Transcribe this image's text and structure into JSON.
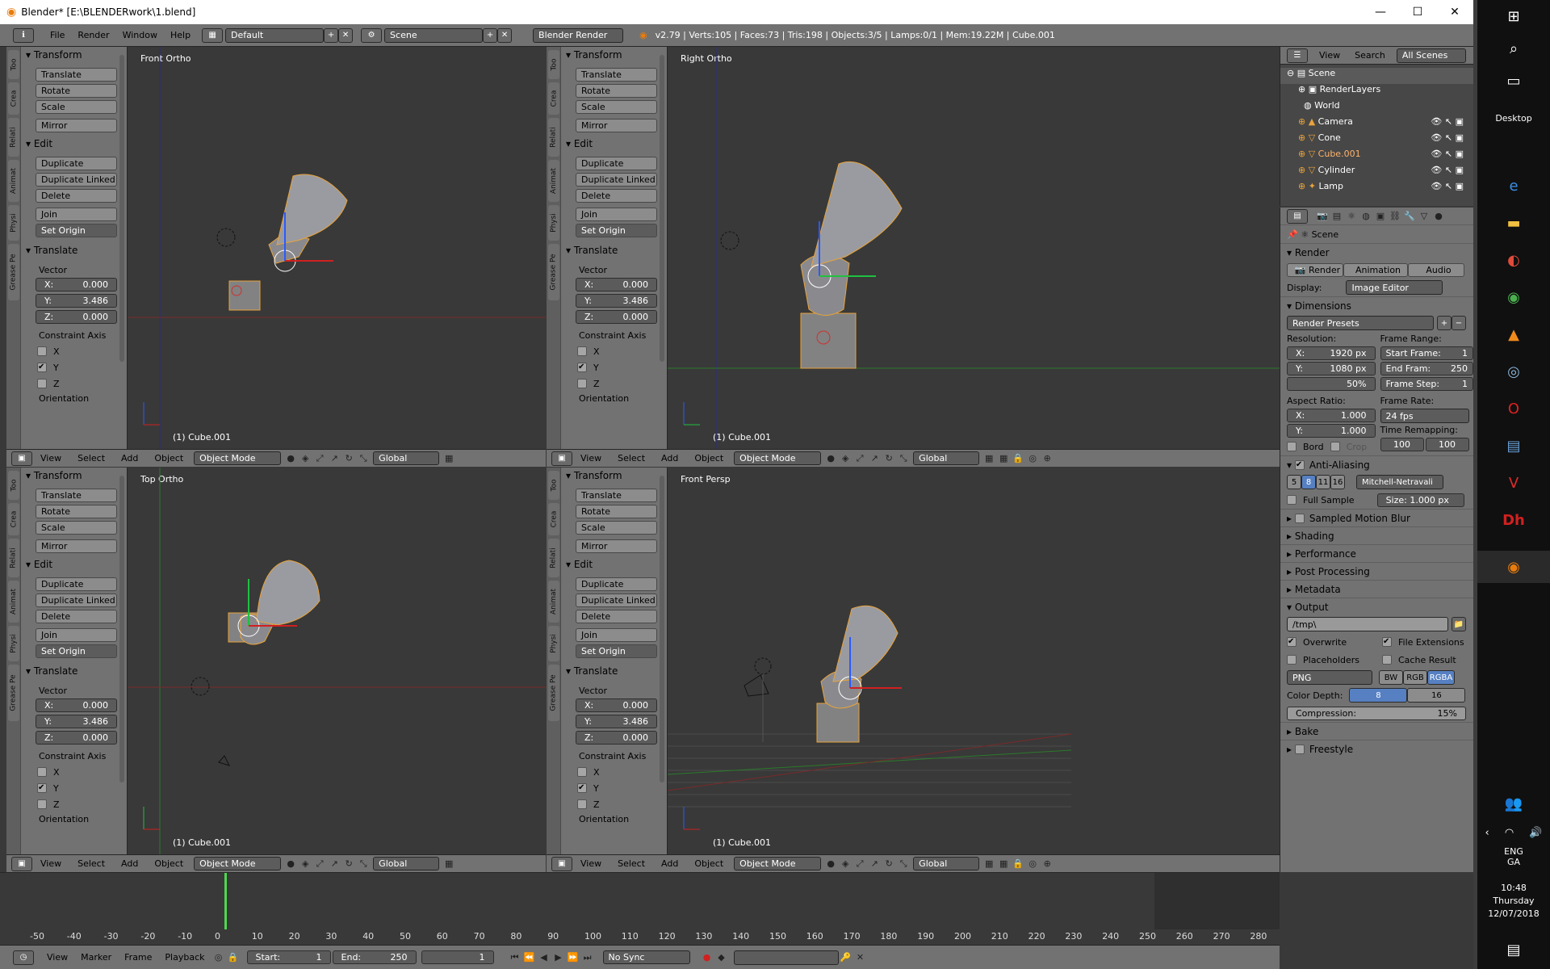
{
  "window": {
    "title": "Blender* [E:\\BLENDERwork\\1.blend]",
    "minimize": "—",
    "maximize": "☐",
    "close": "✕"
  },
  "infobar": {
    "menus": [
      "File",
      "Render",
      "Window",
      "Help"
    ],
    "layout": "Default",
    "scene": "Scene",
    "engine": "Blender Render",
    "stats": "v2.79 | Verts:105 | Faces:73 | Tris:198 | Objects:3/5 | Lamps:0/1 | Mem:19.22M | Cube.001"
  },
  "toolshelf": {
    "tabs": [
      "Too",
      "Crea",
      "Relati",
      "Animat",
      "Physi",
      "Grease Pe"
    ],
    "transform_header": "Transform",
    "transform_buttons": [
      "Translate",
      "Rotate",
      "Scale",
      "Mirror"
    ],
    "edit_header": "Edit",
    "edit_buttons": [
      "Duplicate",
      "Duplicate Linked",
      "Delete",
      "Join"
    ],
    "set_origin": "Set Origin",
    "operator_header": "Translate",
    "vector_label": "Vector",
    "vector": [
      {
        "axis": "X:",
        "value": "0.000"
      },
      {
        "axis": "Y:",
        "value": "3.486"
      },
      {
        "axis": "Z:",
        "value": "0.000"
      }
    ],
    "constraint_label": "Constraint Axis",
    "constraint": [
      {
        "axis": "X",
        "checked": false
      },
      {
        "axis": "Y",
        "checked": true
      },
      {
        "axis": "Z",
        "checked": false
      }
    ],
    "orientation": "Orientation"
  },
  "viewports": [
    {
      "label": "Front Ortho",
      "object": "(1) Cube.001"
    },
    {
      "label": "Right Ortho",
      "object": "(1) Cube.001"
    },
    {
      "label": "Top Ortho",
      "object": "(1) Cube.001"
    },
    {
      "label": "Front Persp",
      "object": "(1) Cube.001"
    }
  ],
  "viewheader": {
    "menus": [
      "View",
      "Select",
      "Add",
      "Object"
    ],
    "mode": "Object Mode",
    "orientation": "Global"
  },
  "outliner": {
    "menus": [
      "View",
      "Search"
    ],
    "filter": "All Scenes",
    "items": [
      "Scene",
      "RenderLayers",
      "World",
      "Camera",
      "Cone",
      "Cube.001",
      "Cylinder",
      "Lamp"
    ]
  },
  "props": {
    "scene": "Scene",
    "render_header": "Render",
    "render_btn": "Render",
    "anim_btn": "Animation",
    "audio_btn": "Audio",
    "display_label": "Display:",
    "display": "Image Editor",
    "dimensions": "Dimensions",
    "presets": "Render Presets",
    "resolution": "Resolution:",
    "res_x": "1920 px",
    "res_y": "1080 px",
    "res_pct": "50%",
    "frame_range": "Frame Range:",
    "start": "Start Frame:",
    "start_v": "1",
    "end": "End Fram:",
    "end_v": "250",
    "step": "Frame Step:",
    "step_v": "1",
    "aspect": "Aspect Ratio:",
    "asp_x": "1.000",
    "asp_y": "1.000",
    "frame_rate": "Frame Rate:",
    "fps": "24 fps",
    "remap": "Time Remapping:",
    "remap_a": "100",
    "remap_b": "100",
    "bord": "Bord",
    "crop": "Crop",
    "aa": "Anti-Aliasing",
    "aa_samples": [
      "5",
      "8",
      "11",
      "16"
    ],
    "filter": "Mitchell-Netravali",
    "full_sample": "Full Sample",
    "size": "Size:  1.000 px",
    "sections": [
      "Sampled Motion Blur",
      "Shading",
      "Performance",
      "Post Processing",
      "Metadata"
    ],
    "output": "Output",
    "path": "/tmp\\",
    "overwrite": "Overwrite",
    "file_ext": "File Extensions",
    "placeholders": "Placeholders",
    "cache": "Cache Result",
    "format": "PNG",
    "bw": "BW",
    "rgb": "RGB",
    "rgba": "RGBA",
    "depth_label": "Color Depth:",
    "depth_8": "8",
    "depth_16": "16",
    "compression": "Compression:",
    "compression_v": "15%",
    "bake": "Bake",
    "freestyle": "Freestyle"
  },
  "timeline": {
    "ticks": [
      "-50",
      "-40",
      "-30",
      "-20",
      "-10",
      "0",
      "10",
      "20",
      "30",
      "40",
      "50",
      "60",
      "70",
      "80",
      "90",
      "100",
      "110",
      "120",
      "130",
      "140",
      "150",
      "160",
      "170",
      "180",
      "190",
      "200",
      "210",
      "220",
      "230",
      "240",
      "250",
      "260",
      "270",
      "280"
    ],
    "menus": [
      "View",
      "Marker",
      "Frame",
      "Playback"
    ],
    "start_label": "Start:",
    "start": "1",
    "end_label": "End:",
    "end": "250",
    "current": "1",
    "sync": "No Sync"
  },
  "taskbar": {
    "desktop": "Desktop",
    "lang": "ENG",
    "lang2": "GA",
    "time": "10:48",
    "day": "Thursday",
    "date": "12/07/2018"
  }
}
